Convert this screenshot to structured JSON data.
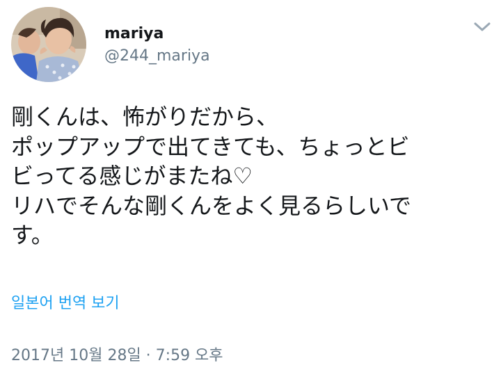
{
  "author": {
    "display_name": "mariya",
    "handle": "@244_mariya",
    "avatar_icon": "profile-photo"
  },
  "menu": {
    "icon": "chevron-down-icon"
  },
  "tweet": {
    "lines": [
      "剛くんは、怖がりだから、",
      "ポップアップで出てきても、ちょっとビ",
      "ビってる感じがまたね♡",
      "リハでそんな剛くんをよく見るらしいで",
      "す。"
    ]
  },
  "translate_label": "일본어 번역 보기",
  "timestamp": "2017년 10월 28일 · 7:59 오후",
  "colors": {
    "link": "#1da1f2",
    "secondary_text": "#657786",
    "primary_text": "#14171a"
  }
}
